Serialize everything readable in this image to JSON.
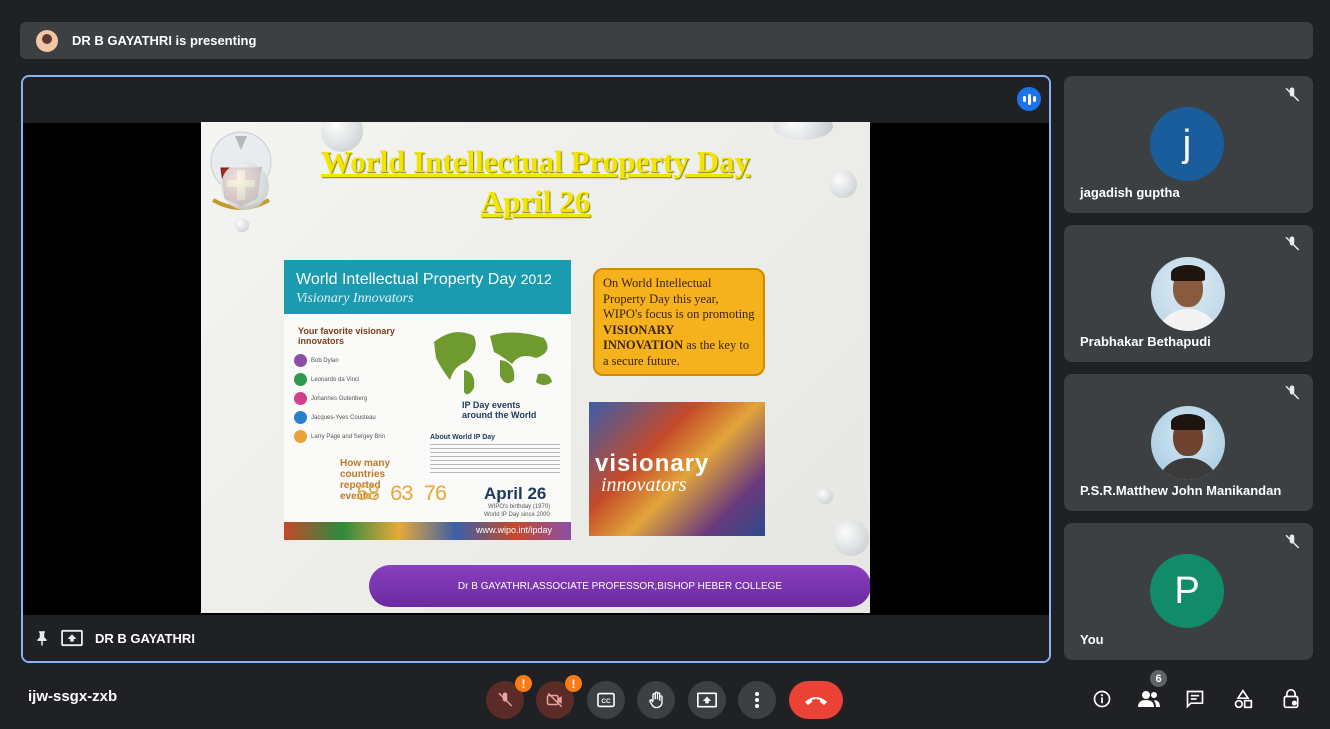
{
  "banner": {
    "text": "DR B GAYATHRI is presenting"
  },
  "stage": {
    "presenter_label": "DR B GAYATHRI"
  },
  "slide": {
    "title_line1": "World Intellectual Property Day",
    "title_line2": "April 26",
    "poster_heading": "World Intellectual Property Day",
    "poster_year": "2012",
    "poster_subheading": "Visionary Innovators",
    "poster_favorites": "Your favorite visionary innovators",
    "innovators": [
      "Bob Dylan",
      "Leonardo da Vinci",
      "Johannes Gutenberg",
      "Jacques-Yves Cousteau",
      "Larry Page and Sergey Brin"
    ],
    "poster_events": "IP Day events around the World",
    "poster_about": "About World IP Day",
    "poster_countries": "How many countries reported events?",
    "poster_counts": "58 63 76",
    "poster_date": "April 26",
    "poster_date_note1": "WIPO's birthday (1970)",
    "poster_date_note2": "World IP Day since 2000",
    "poster_url": "www.wipo.int/ipday",
    "focus_text_1": "On World Intellectual Property Day this year, WIPO's focus is on promoting",
    "focus_text_bold": "VISIONARY INNOVATION",
    "focus_text_2": "as the key to a secure future.",
    "collage_word1": "visionary",
    "collage_word2": "innovators",
    "footer": "Dr B GAYATHRI,ASSOCIATE PROFESSOR,BISHOP HEBER COLLEGE"
  },
  "participants": [
    {
      "name": "jagadish guptha",
      "initial": "j",
      "color": "#1a5d9c",
      "muted": true
    },
    {
      "name": "Prabhakar Bethapudi",
      "initial": "",
      "muted": true
    },
    {
      "name": "P.S.R.Matthew John Manikandan",
      "initial": "",
      "muted": true
    },
    {
      "name": "You",
      "initial": "P",
      "color": "#128b6b",
      "muted": true
    }
  ],
  "meeting": {
    "code": "ijw-ssgx-zxb"
  },
  "controls": {
    "warn1": "!",
    "warn2": "!",
    "people_count": "6"
  },
  "icons": [
    "mic-off-icon",
    "camera-off-icon",
    "captions-icon",
    "raise-hand-icon",
    "present-icon",
    "more-icon",
    "end-call-icon",
    "info-icon",
    "people-icon",
    "chat-icon",
    "activities-icon",
    "host-controls-icon",
    "pin-icon",
    "speaking-icon"
  ]
}
